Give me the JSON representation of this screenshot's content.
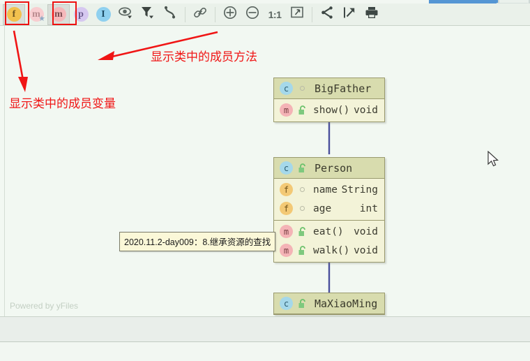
{
  "toolbar": {
    "buttons": [
      {
        "name": "show-fields-button",
        "label": "f",
        "icon": "field-circle-icon",
        "pressed": true,
        "highlighted": true
      },
      {
        "name": "show-non-public-methods-button",
        "label": "m",
        "icon": "method-star-circle-icon",
        "pressed": false,
        "highlighted": false
      },
      {
        "name": "show-methods-button",
        "label": "m",
        "icon": "method-circle-icon",
        "pressed": true,
        "highlighted": true
      },
      {
        "name": "show-properties-button",
        "label": "p",
        "icon": "property-circle-icon",
        "pressed": false,
        "highlighted": false
      },
      {
        "name": "show-interfaces-button",
        "label": "I",
        "icon": "interface-circle-icon",
        "pressed": false,
        "highlighted": false
      },
      {
        "name": "visibility-scope-button",
        "label": "",
        "icon": "eye-dropdown-icon",
        "pressed": false,
        "highlighted": false
      },
      {
        "name": "filter-button",
        "label": "",
        "icon": "funnel-dropdown-icon",
        "pressed": false,
        "highlighted": false
      },
      {
        "name": "edge-mode-button",
        "label": "",
        "icon": "curved-edge-icon",
        "pressed": false,
        "highlighted": false
      },
      {
        "name": "show-dependencies-button",
        "label": "",
        "icon": "link-chain-icon",
        "pressed": false,
        "highlighted": false
      },
      {
        "name": "zoom-in-button",
        "label": "",
        "icon": "plus-circle-icon",
        "pressed": false,
        "highlighted": false
      },
      {
        "name": "zoom-out-button",
        "label": "",
        "icon": "minus-circle-icon",
        "pressed": false,
        "highlighted": false
      },
      {
        "name": "actual-size-button",
        "label": "1:1",
        "icon": "one-to-one-icon",
        "pressed": false,
        "highlighted": false
      },
      {
        "name": "fit-content-button",
        "label": "",
        "icon": "fit-content-icon",
        "pressed": false,
        "highlighted": false
      },
      {
        "name": "layout-button",
        "label": "",
        "icon": "share-graph-icon",
        "pressed": false,
        "highlighted": false
      },
      {
        "name": "export-button",
        "label": "",
        "icon": "export-arrow-icon",
        "pressed": false,
        "highlighted": false
      },
      {
        "name": "print-button",
        "label": "",
        "icon": "printer-icon",
        "pressed": false,
        "highlighted": false
      }
    ]
  },
  "annotations": {
    "methods_note": "显示类中的成员方法",
    "fields_note": "显示类中的成员变量",
    "highlight_color": "#ee1111",
    "text_color": "#f01515"
  },
  "canvas": {
    "watermark": "Powered by yFiles",
    "tooltip": "2020.11.2-day009：8.继承资源的查找",
    "edge_color": "#4a4f9c"
  },
  "diagram": {
    "nodes": [
      {
        "id": "big-father",
        "title": "BigFather",
        "title_icon": "class-icon",
        "title_visibility": "public-dot",
        "fields": [],
        "methods": [
          {
            "icon": "method-icon",
            "visibility": "unlocked-icon",
            "name": "show()",
            "type": "void"
          }
        ]
      },
      {
        "id": "person",
        "title": "Person",
        "title_icon": "class-icon",
        "title_visibility": "unlocked-icon",
        "fields": [
          {
            "icon": "field-icon",
            "visibility": "public-dot",
            "name": "name",
            "type": "String"
          },
          {
            "icon": "field-icon",
            "visibility": "public-dot",
            "name": "age",
            "type": "int"
          }
        ],
        "methods": [
          {
            "icon": "method-icon",
            "visibility": "unlocked-icon",
            "name": "eat()",
            "type": "void"
          },
          {
            "icon": "method-icon",
            "visibility": "unlocked-icon",
            "name": "walk()",
            "type": "void"
          }
        ]
      },
      {
        "id": "ma-xiao-ming",
        "title": "MaXiaoMing",
        "title_icon": "class-icon",
        "title_visibility": "unlocked-icon",
        "fields": [],
        "methods": []
      }
    ],
    "edges": [
      {
        "name": "inheritance-edge-person-to-bigfather",
        "from": "person",
        "to": "big-father"
      },
      {
        "name": "inheritance-edge-maxiaoming-to-person",
        "from": "ma-xiao-ming",
        "to": "person"
      }
    ]
  },
  "colors": {
    "node_header_bg": "#d8dcae",
    "node_body_bg": "#f3f3d8",
    "node_border": "#9a9a6e",
    "canvas_bg": "#f2f8f2",
    "toolbar_bg": "#eaf1ea",
    "title_strip": "#5596d4"
  }
}
